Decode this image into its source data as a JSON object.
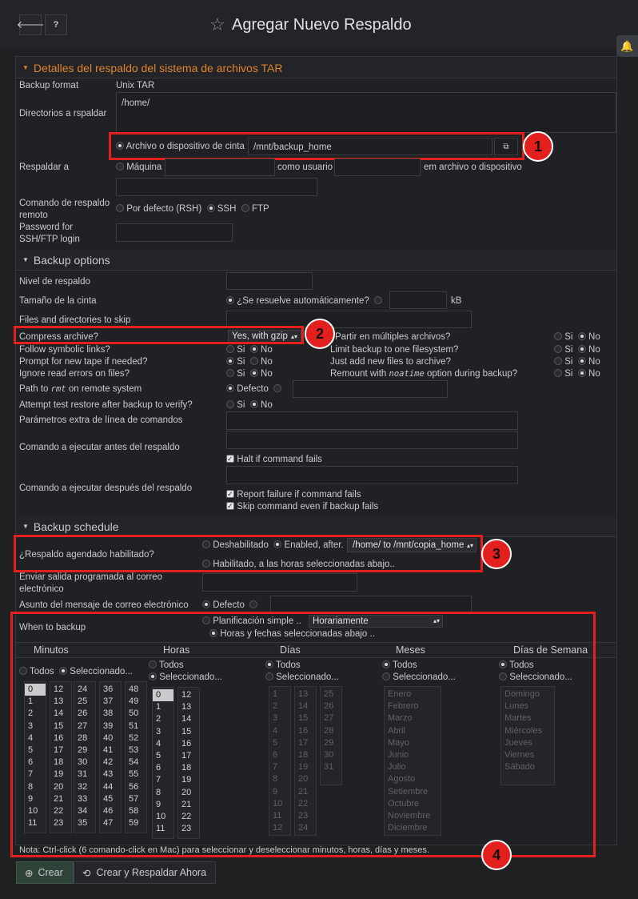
{
  "header": {
    "title": "Agregar Nuevo Respaldo",
    "back_icon": "arrow-left-icon",
    "help_icon": "question-icon",
    "star_icon": "star-icon",
    "bell_icon": "bell-icon"
  },
  "tar_section": {
    "title": "Detalles del respaldo del sistema de archivos TAR",
    "backup_format_label": "Backup format",
    "backup_format_value": "Unix TAR",
    "dirs_label": "Directorios a rspaldar",
    "dirs_value": "/home/",
    "file_or_tape_label": "Archivo o dispositivo de cinta",
    "file_or_tape_value": "/mnt/backup_home",
    "backup_to_label": "Respaldar a",
    "machine_label": "Máquina",
    "as_user_label": "como usuario",
    "in_file_label": "em archivo o dispositivo",
    "remote_cmd_label": "Comando de respaldo remoto",
    "rsh_label": "Por defecto (RSH)",
    "ssh_label": "SSH",
    "ftp_label": "FTP",
    "password_label": "Password for SSH/FTP login"
  },
  "options_section": {
    "title": "Backup options",
    "level_label": "Nivel de respaldo",
    "tape_size_label": "Tamaño de la cinta",
    "tape_auto_label": "¿Se resuelve automáticamente?",
    "kb_label": "kB",
    "skip_label": "Files and directories to skip",
    "compress_label": "Compress archive?",
    "compress_value": "Yes, with gzip",
    "split_label": "Partir en múltiples archivos?",
    "symlinks_label": "Follow symbolic links?",
    "limit_fs_label": "Limit backup to one filesystem?",
    "prompt_tape_label": "Prompt for new tape if needed?",
    "just_add_label": "Just add new files to archive?",
    "ignore_err_label": "Ignore read errors on files?",
    "remount_pre": "Remount with",
    "remount_code": "noatime",
    "remount_post": "option during backup?",
    "path_pre": "Path to",
    "path_code": "rmt",
    "path_post": "on remote system",
    "default_label": "Defecto",
    "test_restore_label": "Attempt test restore after backup to verify?",
    "extra_params_label": "Parámetros extra de línea de comandos",
    "before_cmd_label": "Comando a ejecutar antes del respaldo",
    "halt_label": "Halt if command fails",
    "after_cmd_label": "Comando a ejecutar después del respaldo",
    "report_failure_label": "Report failure if command fails",
    "skip_cmd_label": "Skip command even if backup fails",
    "yes": "Si",
    "no": "No"
  },
  "schedule_section": {
    "title": "Backup schedule",
    "enabled_label": "¿Respaldo agendado habilitado?",
    "disabled": "Deshabilitado",
    "enabled_after": "Enabled, after.",
    "after_value": "/home/ to /mnt/copia_home",
    "enabled_times": "Habilitado, a las horas seleccionadas abajo..",
    "email_label": "Enviar salida programada al correo electrónico",
    "subject_label": "Asunto del mensaje de correo electrónico",
    "default_label": "Defecto",
    "when_label": "When to backup",
    "simple_label": "Planificación simple ..",
    "simple_value": "Horariamente",
    "times_label": "Horas y fechas seleccionadas abajo ..",
    "col_minutes": "Minutos",
    "col_hours": "Horas",
    "col_days": "Días",
    "col_months": "Meses",
    "col_weekdays": "Días de Semana",
    "all": "Todos",
    "selected": "Seleccionado...",
    "minutes": [
      [
        "0",
        "1",
        "2",
        "3",
        "4",
        "5",
        "6",
        "7",
        "8",
        "9",
        "10",
        "11"
      ],
      [
        "12",
        "13",
        "14",
        "15",
        "16",
        "17",
        "18",
        "19",
        "20",
        "21",
        "22",
        "23"
      ],
      [
        "24",
        "25",
        "26",
        "27",
        "28",
        "29",
        "30",
        "31",
        "32",
        "33",
        "34",
        "35"
      ],
      [
        "36",
        "37",
        "38",
        "39",
        "40",
        "41",
        "42",
        "43",
        "44",
        "45",
        "46",
        "47"
      ],
      [
        "48",
        "49",
        "50",
        "51",
        "52",
        "53",
        "54",
        "55",
        "56",
        "57",
        "58",
        "59"
      ]
    ],
    "hours": [
      [
        "0",
        "1",
        "2",
        "3",
        "4",
        "5",
        "6",
        "7",
        "8",
        "9",
        "10",
        "11"
      ],
      [
        "12",
        "13",
        "14",
        "15",
        "16",
        "17",
        "18",
        "19",
        "20",
        "21",
        "22",
        "23"
      ]
    ],
    "days": [
      [
        "1",
        "2",
        "3",
        "4",
        "5",
        "6",
        "7",
        "8",
        "9",
        "10",
        "11",
        "12"
      ],
      [
        "13",
        "14",
        "15",
        "16",
        "17",
        "18",
        "19",
        "20",
        "21",
        "22",
        "23",
        "24"
      ],
      [
        "25",
        "26",
        "27",
        "28",
        "29",
        "30",
        "31"
      ]
    ],
    "months": [
      "Enero",
      "Febrero",
      "Marzo",
      "Abril",
      "Mayo",
      "Junio",
      "Julio",
      "Agosto",
      "Setiembre",
      "Octubre",
      "Noviembre",
      "Diciembre"
    ],
    "weekdays": [
      "Domingo",
      "Lunes",
      "Martes",
      "Miércoles",
      "Jueves",
      "Viernes",
      "Sábado"
    ],
    "note": "Nota: Ctrl-click (6 comando-click en Mac) para seleccionar y deseleccionar minutos, horas, días y meses."
  },
  "buttons": {
    "create": "Crear",
    "create_now": "Crear y Respaldar Ahora"
  },
  "callouts": [
    "1",
    "2",
    "3",
    "4"
  ],
  "colors": {
    "accent": "#e2832b",
    "callout": "#e3201d"
  }
}
